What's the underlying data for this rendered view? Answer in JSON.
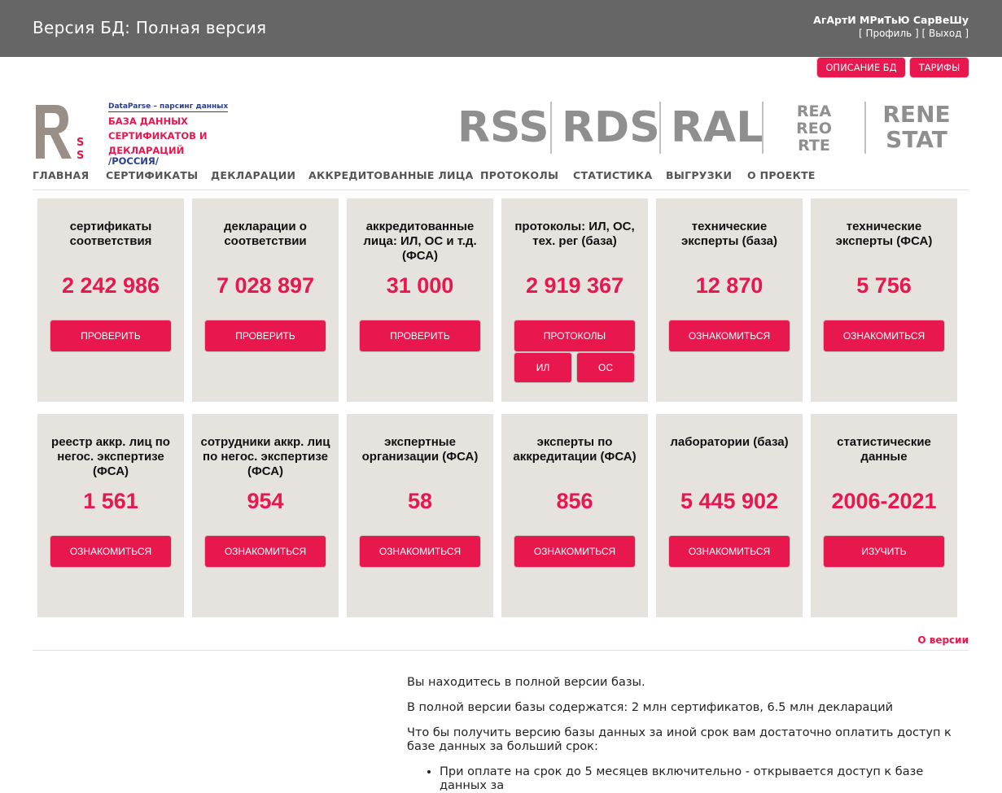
{
  "header": {
    "db_version": "Версия БД: Полная версия",
    "user_name": "АгАртИ МРиТьЮ СарВеШу",
    "profile_link": "Профиль",
    "logout_link": "Выход"
  },
  "top_buttons": {
    "db_description": "ОПИСАНИЕ БД",
    "tariffs": "ТАРИФЫ"
  },
  "logo": {
    "mark": "R",
    "mark_sub": "SS",
    "tagline": "DataParse – парсинг данных",
    "line1": "БАЗА ДАННЫХ",
    "line2": "СЕРТИФИКАТОВ И",
    "line3": "ДЕКЛАРАЦИЙ",
    "line4": "/РОССИЯ/"
  },
  "brands": [
    "RSS",
    "RDS",
    "RAL",
    "REA REO RTE",
    "RENE STAT"
  ],
  "nav": [
    "ГЛАВНАЯ",
    "СЕРТИФИКАТЫ",
    "ДЕКЛАРАЦИИ",
    "АККРЕДИТОВАННЫЕ ЛИЦА",
    "ПРОТОКОЛЫ",
    "СТАТИСТИКА",
    "ВЫГРУЗКИ",
    "О ПРОЕКТЕ"
  ],
  "cards": [
    {
      "title": "сертификаты соответствия",
      "count": "2 242 986",
      "button": "ПРОВЕРИТЬ"
    },
    {
      "title": "декларации о соответствии",
      "count": "7 028 897",
      "button": "ПРОВЕРИТЬ"
    },
    {
      "title": "аккредитованные лица: ИЛ, ОС и т.д. (ФСА)",
      "count": "31 000",
      "button": "ПРОВЕРИТЬ"
    },
    {
      "title": "протоколы: ИЛ, ОС, тех. рег (база)",
      "count": "2 919 367",
      "button": "ПРОТОКОЛЫ",
      "sub_buttons": [
        "ИЛ",
        "ОС"
      ]
    },
    {
      "title": "технические эксперты (база)",
      "count": "12 870",
      "button": "ОЗНАКОМИТЬСЯ"
    },
    {
      "title": "технические эксперты (ФСА)",
      "count": "5 756",
      "button": "ОЗНАКОМИТЬСЯ"
    },
    {
      "title": "реестр аккр. лиц по негос. экспертизе (ФСА)",
      "count": "1 561",
      "button": "ОЗНАКОМИТЬСЯ"
    },
    {
      "title": "сотрудники аккр. лиц по негос. экспертизе (ФСА)",
      "count": "954",
      "button": "ОЗНАКОМИТЬСЯ"
    },
    {
      "title": "экспертные организации (ФСА)",
      "count": "58",
      "button": "ОЗНАКОМИТЬСЯ"
    },
    {
      "title": "эксперты по аккредитации (ФСА)",
      "count": "856",
      "button": "ОЗНАКОМИТЬСЯ"
    },
    {
      "title": "лаборатории (база)",
      "count": "5 445 902",
      "button": "ОЗНАКОМИТЬСЯ"
    },
    {
      "title": "статистические данные",
      "count": "2006-2021",
      "button": "ИЗУЧИТЬ"
    }
  ],
  "about_version_link": "О версии",
  "info": {
    "p1": "Вы находитесь в полной версии базы.",
    "p2": "В полной версии базы содержатся: 2 млн сертификатов, 6.5 млн деклараций",
    "p3": "Что бы получить версию базы данных за иной срок вам достаточно оплатить доступ к базе данных за больший срок:",
    "li1": "При оплате на срок до 5 месяцев включительно - открывается доступ к базе данных за"
  },
  "colors": {
    "topbar": "#666666",
    "accent": "#e8174e",
    "card_bg": "#e6e2de",
    "brand_gray": "#8f8f8f",
    "logo_blue": "#2a3e8c"
  }
}
